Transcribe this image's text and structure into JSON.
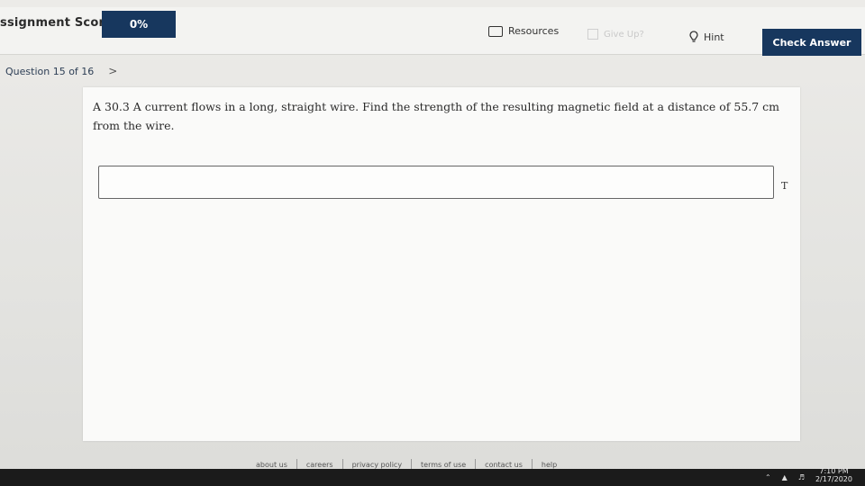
{
  "header": {
    "score_label": "ssignment Score:",
    "score_value": "0%",
    "resources_label": "Resources",
    "giveup_label": "Give Up?",
    "hint_label": "Hint",
    "check_answer_label": "Check Answer"
  },
  "question": {
    "nav_label": "Question 15 of 16",
    "next_symbol": ">",
    "text": "A 30.3 A current flows in a long, straight wire. Find the strength of the resulting magnetic field at a distance of 55.7 cm from the wire.",
    "answer_value": "",
    "unit": "T"
  },
  "footer": {
    "links": [
      "about us",
      "careers",
      "privacy policy",
      "terms of use",
      "contact us",
      "help"
    ]
  },
  "taskbar": {
    "time": "7:10 PM",
    "date": "2/17/2020"
  },
  "colors": {
    "brand_navy": "#17375e"
  },
  "icons": {
    "resources": "folder-icon",
    "giveup": "give-up-icon",
    "hint": "lightbulb-icon",
    "next": "chevron-right-icon"
  }
}
